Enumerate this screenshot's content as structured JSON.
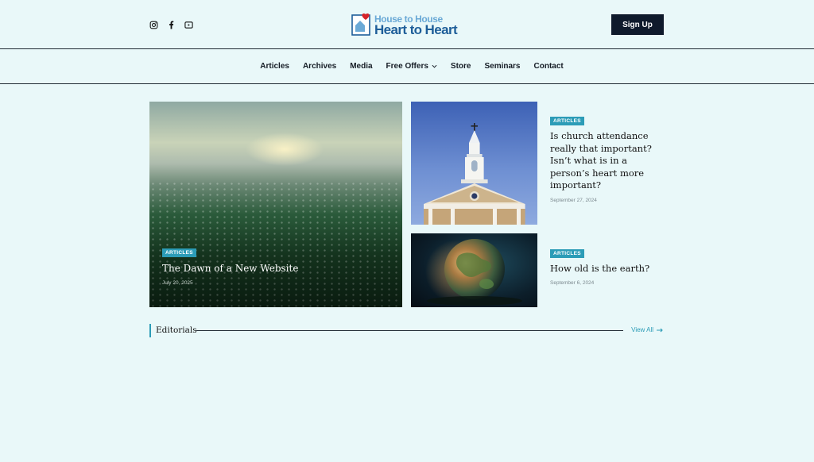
{
  "header": {
    "social": [
      "instagram-icon",
      "facebook-icon",
      "youtube-icon"
    ],
    "logo": {
      "line1": "House to House",
      "line2": "Heart to Heart"
    },
    "signup_label": "Sign Up"
  },
  "nav": {
    "items": [
      "Articles",
      "Archives",
      "Media",
      "Free Offers",
      "Store",
      "Seminars",
      "Contact"
    ]
  },
  "featured": {
    "tag": "ARTICLES",
    "title": "The Dawn of a New Website",
    "date": "July 20, 2025"
  },
  "side_posts": [
    {
      "tag": "ARTICLES",
      "title": "Is church attendance really that important? Isn’t what is in a person’s heart more important?",
      "date": "September 27, 2024"
    },
    {
      "tag": "ARTICLES",
      "title": "How old is the earth?",
      "date": "September 6, 2024"
    }
  ],
  "editorials": {
    "heading": "Editorials",
    "view_all": "View All"
  },
  "colors": {
    "accent": "#2c9cb7",
    "background": "#e9f8f9",
    "button": "#0f1a2c",
    "logo_dark": "#1e5e99",
    "logo_light": "#6aa9d6"
  }
}
